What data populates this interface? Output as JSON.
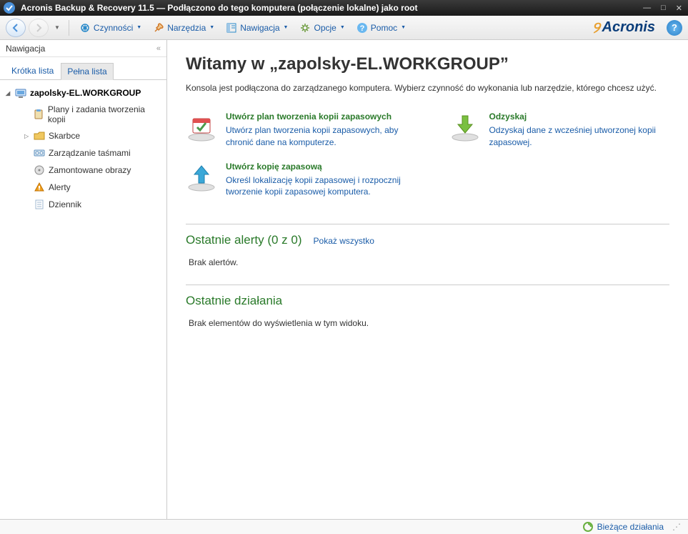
{
  "window": {
    "title": "Acronis Backup & Recovery 11.5 — Podłączono do tego komputera (połączenie lokalne) jako root"
  },
  "toolbar": {
    "actions": "Czynności",
    "tools": "Narzędzia",
    "navigation": "Nawigacja",
    "options": "Opcje",
    "help": "Pomoc",
    "brand": "Acronis"
  },
  "sidebar": {
    "title": "Nawigacja",
    "tabs": {
      "short": "Krótka lista",
      "full": "Pełna lista"
    },
    "root": "zapolsky-EL.WORKGROUP",
    "items": [
      {
        "label": "Plany i zadania tworzenia kopii"
      },
      {
        "label": "Skarbce",
        "expandable": true
      },
      {
        "label": "Zarządzanie taśmami"
      },
      {
        "label": "Zamontowane obrazy"
      },
      {
        "label": "Alerty"
      },
      {
        "label": "Dziennik"
      }
    ]
  },
  "content": {
    "welcome_title": "Witamy w „zapolsky-EL.WORKGROUP”",
    "welcome_desc": "Konsola jest podłączona do zarządzanego komputera. Wybierz czynność do wykonania lub narzędzie, którego chcesz użyć.",
    "actions": {
      "plan": {
        "title": "Utwórz plan tworzenia kopii zapasowych",
        "desc": "Utwórz plan tworzenia kopii zapasowych, aby chronić dane na komputerze."
      },
      "backup": {
        "title": "Utwórz kopię zapasową",
        "desc": "Określ lokalizację kopii zapasowej i rozpocznij tworzenie kopii zapasowej komputera."
      },
      "recover": {
        "title": "Odzyskaj",
        "desc": "Odzyskaj dane z wcześniej utworzonej kopii zapasowej."
      }
    },
    "alerts": {
      "title": "Ostatnie alerty (0 z 0)",
      "show_all": "Pokaż wszystko",
      "empty": "Brak alertów."
    },
    "activities": {
      "title": "Ostatnie działania",
      "empty": "Brak elementów do wyświetlenia w tym widoku."
    }
  },
  "statusbar": {
    "current": "Bieżące działania"
  }
}
